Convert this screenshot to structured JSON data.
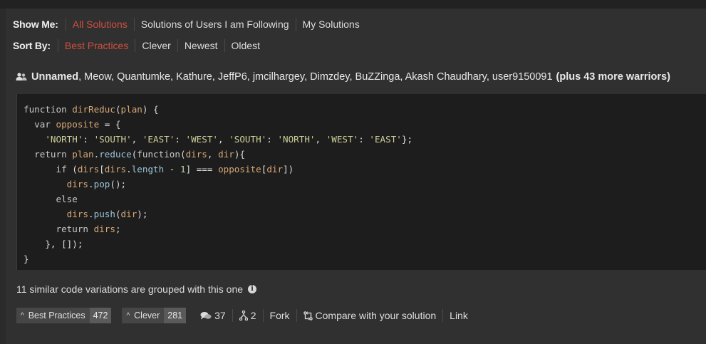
{
  "filters": {
    "show_me": {
      "label": "Show Me:",
      "options": [
        "All Solutions",
        "Solutions of Users I am Following",
        "My Solutions"
      ],
      "active": "All Solutions"
    },
    "sort_by": {
      "label": "Sort By:",
      "options": [
        "Best Practices",
        "Clever",
        "Newest",
        "Oldest"
      ],
      "active": "Best Practices"
    }
  },
  "solution": {
    "authors_first": "Unnamed",
    "authors_rest": ", Meow, Quantumke, Kathure, JeffP6, jmcilhargey, Dimzdey, BuZZinga, Akash Chaudhary, user9150091",
    "more_warriors": "(plus 43 more warriors)",
    "code_lines": [
      "function dirReduc(plan) {",
      "  var opposite = {",
      "    'NORTH': 'SOUTH', 'EAST': 'WEST', 'SOUTH': 'NORTH', 'WEST': 'EAST'};",
      "  return plan.reduce(function(dirs, dir){",
      "      if (dirs[dirs.length - 1] === opposite[dir])",
      "        dirs.pop();",
      "      else",
      "        dirs.push(dir);",
      "      return dirs;",
      "    }, []);",
      "}"
    ],
    "variations_text": "11 similar code variations are grouped with this one",
    "votes": {
      "best_practices": {
        "label": "Best Practices",
        "count": "472"
      },
      "clever": {
        "label": "Clever",
        "count": "281"
      }
    },
    "comments": "37",
    "forks": "2",
    "fork_label": "Fork",
    "compare_label": "Compare with your solution",
    "link_label": "Link"
  },
  "colors": {
    "accent": "#cf4f3f",
    "panel": "#303030",
    "code_bg": "#1d1d1d"
  },
  "icons": [
    "users-icon",
    "info-icon",
    "caret-up-icon",
    "comments-icon",
    "fork-icon",
    "compare-icon"
  ]
}
